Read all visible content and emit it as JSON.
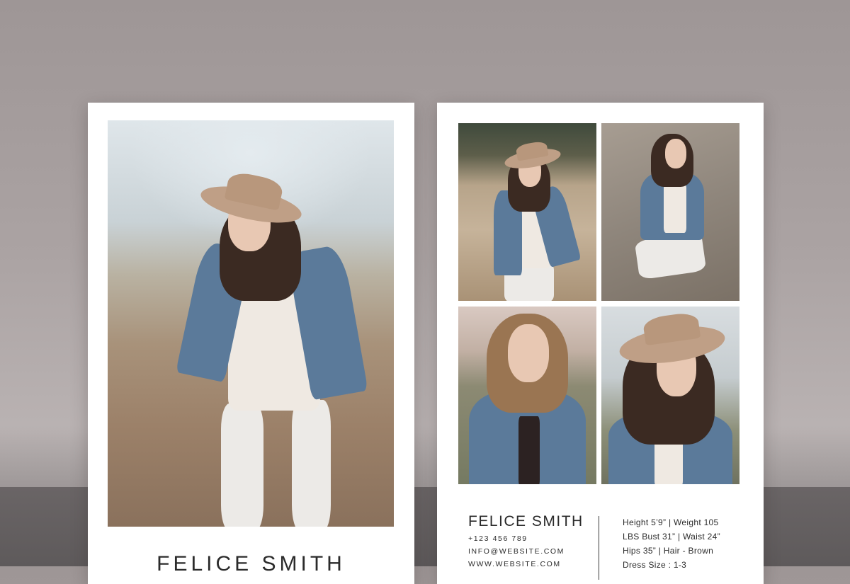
{
  "front": {
    "name": "FELICE SMITH"
  },
  "back": {
    "name": "FELICE SMITH",
    "contact": {
      "phone": "+123 456 789",
      "email": "INFO@WEBSITE.COM",
      "website": "WWW.WEBSITE.COM"
    },
    "stats": [
      "Height 5’9” | Weight 105",
      "LBS Bust 31” | Waist 24”",
      "Hips 35” | Hair - Brown",
      "Dress Size : 1-3"
    ]
  },
  "colors": {
    "background": "#aba3a3",
    "floor": "#625e5f",
    "card": "#ffffff",
    "text": "#2b2b2b",
    "denim": "#5b7a9a",
    "hat": "#bf9f86"
  }
}
